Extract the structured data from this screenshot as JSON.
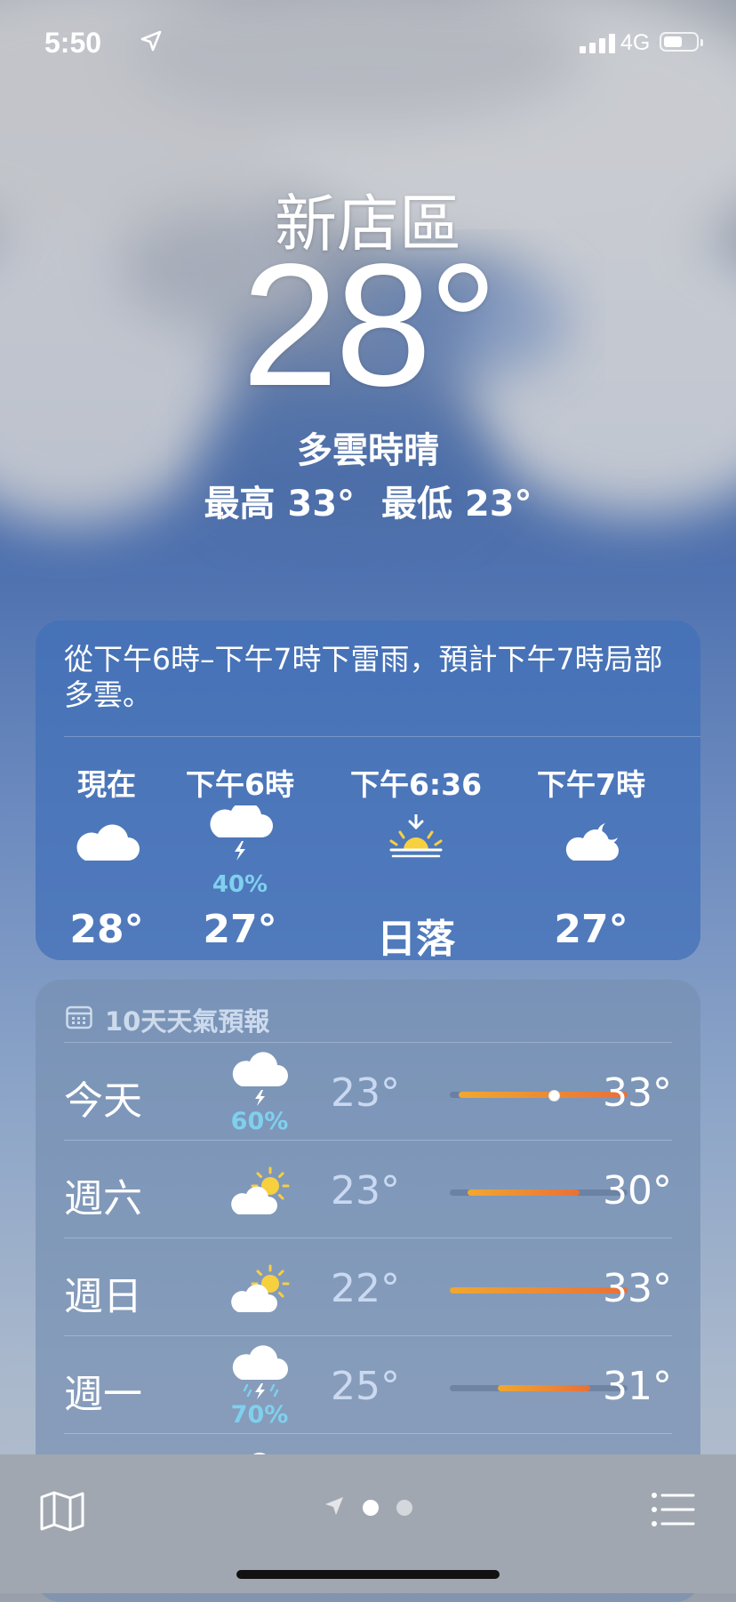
{
  "status_bar": {
    "time": "5:50",
    "network": "4G",
    "battery_level": 0.6
  },
  "current": {
    "location": "新店區",
    "temperature": "28°",
    "condition": "多雲時晴",
    "high": "最高 33°",
    "low": "最低 23°"
  },
  "hourly_card": {
    "summary": "從下午6時–下午7時下雷雨，預計下午7時局部多雲。",
    "hours": [
      {
        "label": "現在",
        "icon": "cloud-icon",
        "pop": "",
        "value": "28°"
      },
      {
        "label": "下午6時",
        "icon": "thunderstorm-icon",
        "pop": "40%",
        "value": "27°"
      },
      {
        "label": "下午6:36",
        "icon": "sunset-icon",
        "pop": "",
        "value": "日落"
      },
      {
        "label": "下午7時",
        "icon": "cloud-moon-icon",
        "pop": "",
        "value": "27°"
      }
    ]
  },
  "forecast": {
    "title": "10天天氣預報",
    "days": [
      {
        "day": "今天",
        "icon": "thunderstorm-icon",
        "pop": "60%",
        "low": "23°",
        "high": "33°",
        "bar_start": 0.05,
        "bar_end": 1.0,
        "current_marker": 0.58
      },
      {
        "day": "週六",
        "icon": "partly-sunny-icon",
        "pop": "",
        "low": "23°",
        "high": "30°",
        "bar_start": 0.1,
        "bar_end": 0.73
      },
      {
        "day": "週日",
        "icon": "partly-sunny-icon",
        "pop": "",
        "low": "22°",
        "high": "33°",
        "bar_start": 0.0,
        "bar_end": 1.0
      },
      {
        "day": "週一",
        "icon": "heavy-thunderstorm-icon",
        "pop": "70%",
        "low": "25°",
        "high": "31°",
        "bar_start": 0.27,
        "bar_end": 0.79
      }
    ]
  },
  "colors": {
    "pop_text": "#7fd0ee",
    "bar_warm": "#f0a830",
    "bar_hot": "#e8703a"
  },
  "tab_bar": {
    "page_dots": 2,
    "active_page": 1
  }
}
